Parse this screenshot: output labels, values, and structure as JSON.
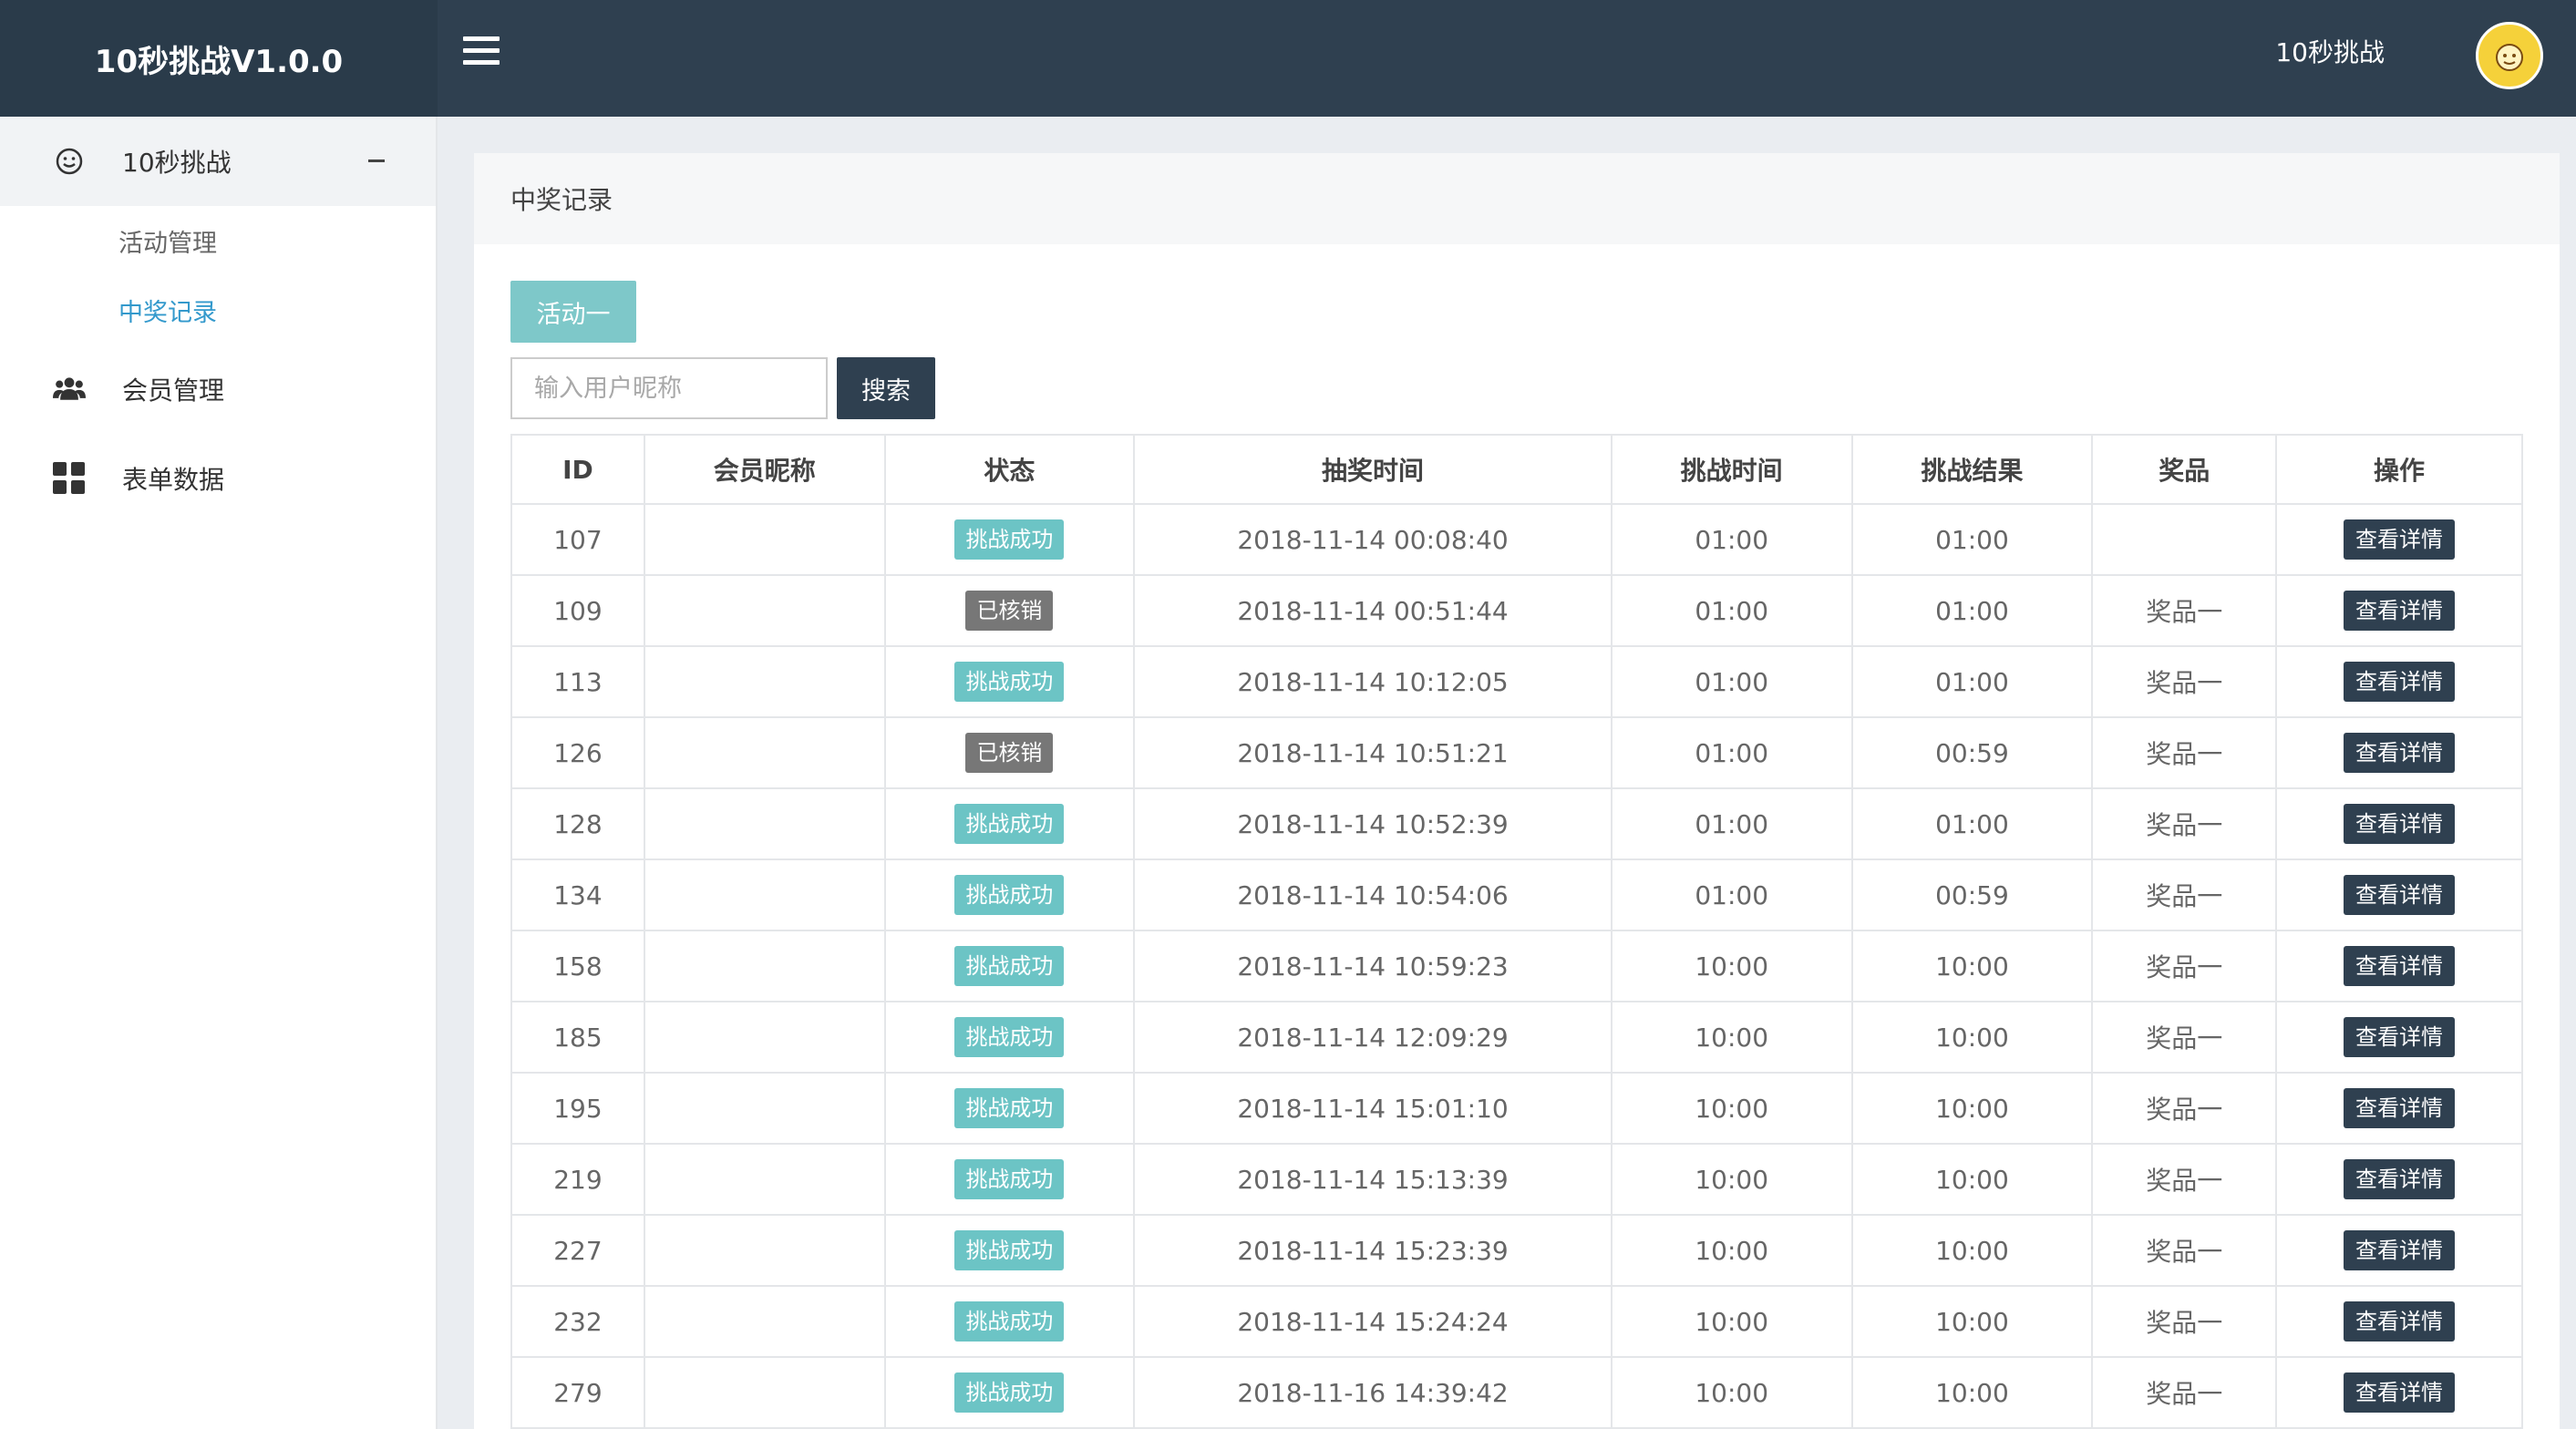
{
  "header": {
    "brand": "10秒挑战V1.0.0",
    "username": "10秒挑战",
    "avatar_icon": "cartoon-avatar"
  },
  "sidebar": {
    "groups": [
      {
        "label": "10秒挑战",
        "icon": "smiley-icon",
        "expanded": true,
        "items": [
          {
            "label": "活动管理"
          },
          {
            "label": "中奖记录",
            "current": true
          }
        ]
      },
      {
        "label": "会员管理",
        "icon": "users-icon"
      },
      {
        "label": "表单数据",
        "icon": "grid-icon"
      }
    ]
  },
  "main": {
    "title": "中奖记录",
    "tab_label": "活动一",
    "search": {
      "placeholder": "输入用户昵称",
      "value": "",
      "button_label": "搜索"
    },
    "table": {
      "headers": [
        "ID",
        "会员昵称",
        "状态",
        "抽奖时间",
        "挑战时间",
        "挑战结果",
        "奖品",
        "操作"
      ],
      "action_label": "查看详情",
      "rows": [
        {
          "id": "107",
          "nickname": "",
          "status": "挑战成功",
          "status_type": "success",
          "draw_time": "2018-11-14 00:08:40",
          "challenge_time": "01:00",
          "result": "01:00",
          "prize": ""
        },
        {
          "id": "109",
          "nickname": "",
          "status": "已核销",
          "status_type": "done",
          "draw_time": "2018-11-14 00:51:44",
          "challenge_time": "01:00",
          "result": "01:00",
          "prize": "奖品一"
        },
        {
          "id": "113",
          "nickname": "",
          "status": "挑战成功",
          "status_type": "success",
          "draw_time": "2018-11-14 10:12:05",
          "challenge_time": "01:00",
          "result": "01:00",
          "prize": "奖品一"
        },
        {
          "id": "126",
          "nickname": "",
          "status": "已核销",
          "status_type": "done",
          "draw_time": "2018-11-14 10:51:21",
          "challenge_time": "01:00",
          "result": "00:59",
          "prize": "奖品一"
        },
        {
          "id": "128",
          "nickname": "",
          "status": "挑战成功",
          "status_type": "success",
          "draw_time": "2018-11-14 10:52:39",
          "challenge_time": "01:00",
          "result": "01:00",
          "prize": "奖品一"
        },
        {
          "id": "134",
          "nickname": "",
          "status": "挑战成功",
          "status_type": "success",
          "draw_time": "2018-11-14 10:54:06",
          "challenge_time": "01:00",
          "result": "00:59",
          "prize": "奖品一"
        },
        {
          "id": "158",
          "nickname": "",
          "status": "挑战成功",
          "status_type": "success",
          "draw_time": "2018-11-14 10:59:23",
          "challenge_time": "10:00",
          "result": "10:00",
          "prize": "奖品一"
        },
        {
          "id": "185",
          "nickname": "",
          "status": "挑战成功",
          "status_type": "success",
          "draw_time": "2018-11-14 12:09:29",
          "challenge_time": "10:00",
          "result": "10:00",
          "prize": "奖品一"
        },
        {
          "id": "195",
          "nickname": "",
          "status": "挑战成功",
          "status_type": "success",
          "draw_time": "2018-11-14 15:01:10",
          "challenge_time": "10:00",
          "result": "10:00",
          "prize": "奖品一"
        },
        {
          "id": "219",
          "nickname": "",
          "status": "挑战成功",
          "status_type": "success",
          "draw_time": "2018-11-14 15:13:39",
          "challenge_time": "10:00",
          "result": "10:00",
          "prize": "奖品一"
        },
        {
          "id": "227",
          "nickname": "",
          "status": "挑战成功",
          "status_type": "success",
          "draw_time": "2018-11-14 15:23:39",
          "challenge_time": "10:00",
          "result": "10:00",
          "prize": "奖品一"
        },
        {
          "id": "232",
          "nickname": "",
          "status": "挑战成功",
          "status_type": "success",
          "draw_time": "2018-11-14 15:24:24",
          "challenge_time": "10:00",
          "result": "10:00",
          "prize": "奖品一"
        },
        {
          "id": "279",
          "nickname": "",
          "status": "挑战成功",
          "status_type": "success",
          "draw_time": "2018-11-16 14:39:42",
          "challenge_time": "10:00",
          "result": "10:00",
          "prize": "奖品一"
        }
      ]
    }
  },
  "colors": {
    "header_bg": "#2f4050",
    "accent_teal": "#7ec8c9",
    "badge_success": "#6cc4c5",
    "badge_done": "#777777",
    "link_blue": "#3399cc"
  }
}
